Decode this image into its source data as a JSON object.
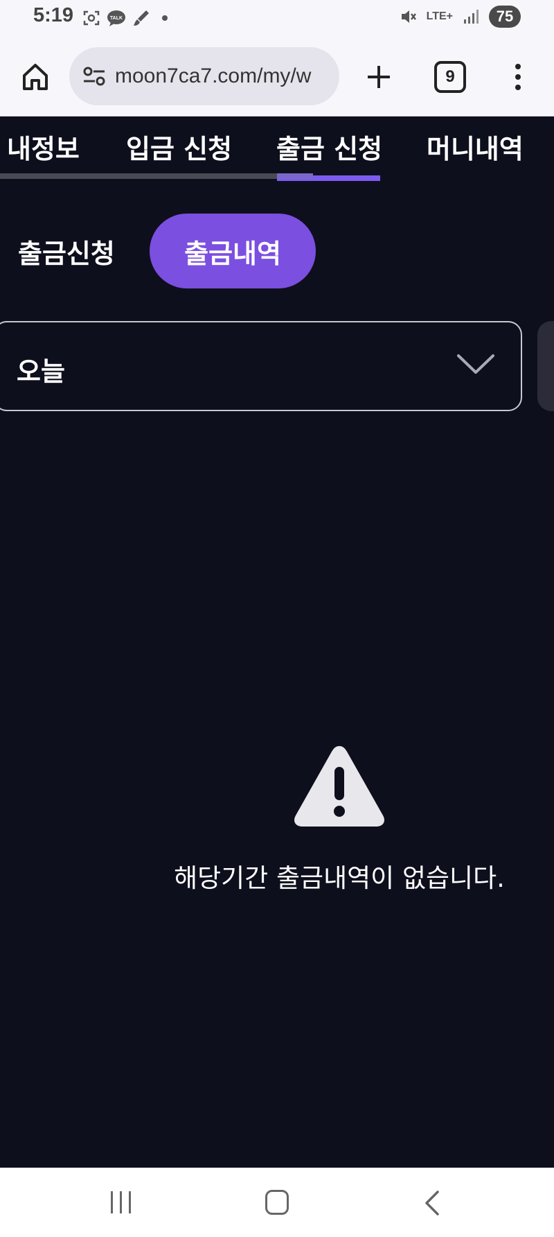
{
  "status_bar": {
    "time": "5:19",
    "network": "LTE+",
    "battery": "75",
    "icons": [
      "screenshot-icon",
      "talk-icon",
      "brush-icon",
      "notification-dot",
      "mute-icon",
      "lte-icon",
      "signal-icon",
      "battery-icon"
    ]
  },
  "browser": {
    "url": "moon7ca7.com/my/w",
    "tab_count": "9",
    "icons": [
      "home-icon",
      "site-settings-icon",
      "new-tab-icon",
      "tabs-icon",
      "more-menu-icon"
    ]
  },
  "top_tabs": [
    {
      "label": "내정보"
    },
    {
      "label": "입금 신청"
    },
    {
      "label": "출금 신청",
      "active": true
    },
    {
      "label": "머니내역"
    }
  ],
  "sub_tabs": {
    "request": "출금신청",
    "history": "출금내역"
  },
  "period_select": {
    "value": "오늘"
  },
  "empty_state": {
    "message": "해당기간 출금내역이 없습니다."
  },
  "colors": {
    "background": "#0e0f1d",
    "accent": "#7b4fe0",
    "indicator": "#7b5bf0"
  }
}
